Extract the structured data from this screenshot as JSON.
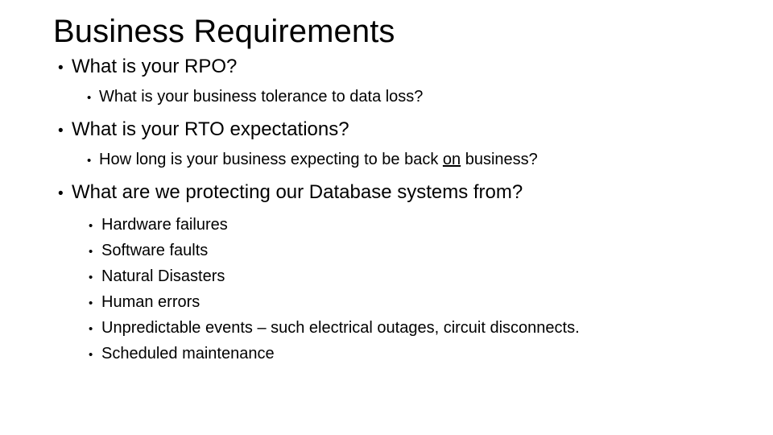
{
  "slide": {
    "title": "Business Requirements",
    "bullet_char": "•",
    "text_color": "#000000",
    "background_color": "#ffffff",
    "sections": [
      {
        "level1": "What is your RPO?",
        "level2": [
          {
            "prefix": "What is your business tolerance to data loss?",
            "emphasis": "",
            "suffix": ""
          }
        ],
        "level3": []
      },
      {
        "level1": "What is your RTO expectations?",
        "level2": [
          {
            "prefix": "How long is your business expecting to be back ",
            "emphasis": "on",
            "suffix": " business?"
          }
        ],
        "level3": []
      },
      {
        "level1": "What are we protecting our Database systems from?",
        "level2": [],
        "level3": [
          "Hardware failures",
          "Software faults",
          "Natural Disasters",
          "Human errors",
          "Unpredictable events – such electrical outages, circuit disconnects.",
          "Scheduled maintenance"
        ]
      }
    ]
  }
}
